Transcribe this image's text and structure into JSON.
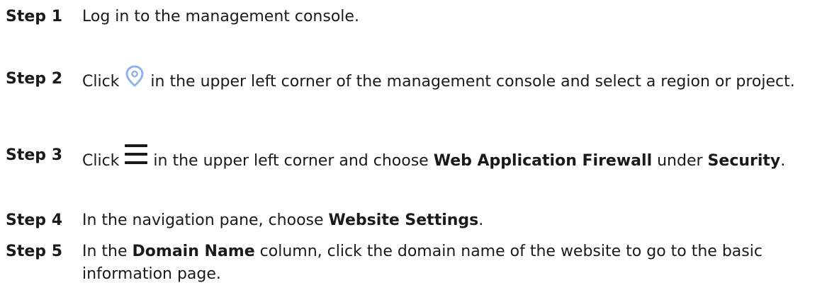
{
  "steps": [
    {
      "label": "Step 1",
      "parts": [
        "Log in to the management console."
      ]
    },
    {
      "label": "Step 2",
      "pre": "Click",
      "icon": "location-pin-icon",
      "post": "in the upper left corner of the management console and select a region or project."
    },
    {
      "label": "Step 3",
      "pre": "Click",
      "icon": "hamburger-menu-icon",
      "post1": "in the upper left corner and choose",
      "bold1": "Web Application Firewall",
      "post2": "under",
      "bold2": "Security",
      "post3": "."
    },
    {
      "label": "Step 4",
      "pre": "In the navigation pane, choose",
      "bold1": "Website Settings",
      "post": "."
    },
    {
      "label": "Step 5",
      "pre": "In the",
      "bold1": "Domain Name",
      "post": "column, click the domain name of the website to go to the basic information page."
    }
  ],
  "colors": {
    "text": "#1a1a1a",
    "pin_icon": "#8fb3ea"
  }
}
